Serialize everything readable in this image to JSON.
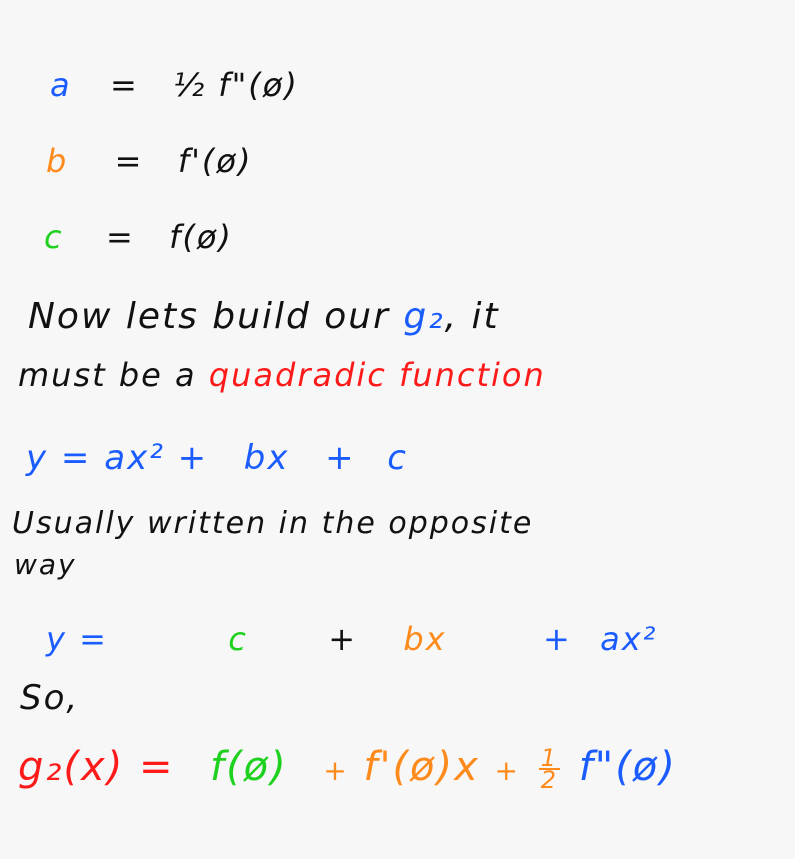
{
  "colors": {
    "blue": "#1a5cff",
    "orange": "#ff8a1c",
    "green": "#1fd11f",
    "red": "#ff1a1a",
    "black": "#111111"
  },
  "lines": {
    "a_def": {
      "var": "a",
      "eq": "=",
      "rhs": "½ f\"(ø)"
    },
    "b_def": {
      "var": "b",
      "eq": "=",
      "rhs": "f'(ø)"
    },
    "c_def": {
      "var": "c",
      "eq": "=",
      "rhs": "f(ø)"
    },
    "sentence1": {
      "text": "Now lets build our",
      "g2": "g₂",
      "rest": ", it"
    },
    "sentence2": {
      "text": "must be a",
      "highlight": "quadradic function"
    },
    "eq1": {
      "lhs": "y =",
      "ax2": "ax²",
      "plus1": "+",
      "bx": "bx",
      "plus2": "+",
      "c": "c"
    },
    "sentence3": "Usually written in the opposite",
    "sentence4": "way",
    "eq2": {
      "lhs": "y =",
      "c": "c",
      "plus1": "+",
      "bx": "bx",
      "plus2": "+",
      "ax2": "ax²"
    },
    "so": "So,",
    "final": {
      "g2x": "g₂(x)",
      "eq": "=",
      "f0": "f(ø)",
      "plus1": "+",
      "fp0x": "f'(ø)x",
      "plus2": "+",
      "frac_num": "1",
      "frac_den": "2",
      "fpp0": "f\"(ø)"
    }
  }
}
